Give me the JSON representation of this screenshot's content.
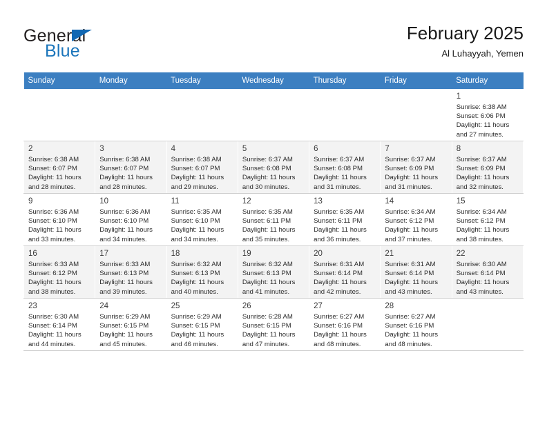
{
  "brand": {
    "name_part1": "General",
    "name_part2": "Blue",
    "triangle_color": "#1268b3",
    "blue_color": "#1b75bb"
  },
  "header": {
    "title": "February 2025",
    "subtitle": "Al Luhayyah, Yemen"
  },
  "colors": {
    "header_row_bg": "#3c7fc1",
    "header_row_text": "#ffffff",
    "week_stripe_bg": "#f3f3f3",
    "cell_bg": "#ffffff",
    "grid_line": "#cfcfcf"
  },
  "weekdays": [
    "Sunday",
    "Monday",
    "Tuesday",
    "Wednesday",
    "Thursday",
    "Friday",
    "Saturday"
  ],
  "weeks": [
    [
      {
        "day": "",
        "info": ""
      },
      {
        "day": "",
        "info": ""
      },
      {
        "day": "",
        "info": ""
      },
      {
        "day": "",
        "info": ""
      },
      {
        "day": "",
        "info": ""
      },
      {
        "day": "",
        "info": ""
      },
      {
        "day": "1",
        "info": "Sunrise: 6:38 AM\nSunset: 6:06 PM\nDaylight: 11 hours\nand 27 minutes."
      }
    ],
    [
      {
        "day": "2",
        "info": "Sunrise: 6:38 AM\nSunset: 6:07 PM\nDaylight: 11 hours\nand 28 minutes."
      },
      {
        "day": "3",
        "info": "Sunrise: 6:38 AM\nSunset: 6:07 PM\nDaylight: 11 hours\nand 28 minutes."
      },
      {
        "day": "4",
        "info": "Sunrise: 6:38 AM\nSunset: 6:07 PM\nDaylight: 11 hours\nand 29 minutes."
      },
      {
        "day": "5",
        "info": "Sunrise: 6:37 AM\nSunset: 6:08 PM\nDaylight: 11 hours\nand 30 minutes."
      },
      {
        "day": "6",
        "info": "Sunrise: 6:37 AM\nSunset: 6:08 PM\nDaylight: 11 hours\nand 31 minutes."
      },
      {
        "day": "7",
        "info": "Sunrise: 6:37 AM\nSunset: 6:09 PM\nDaylight: 11 hours\nand 31 minutes."
      },
      {
        "day": "8",
        "info": "Sunrise: 6:37 AM\nSunset: 6:09 PM\nDaylight: 11 hours\nand 32 minutes."
      }
    ],
    [
      {
        "day": "9",
        "info": "Sunrise: 6:36 AM\nSunset: 6:10 PM\nDaylight: 11 hours\nand 33 minutes."
      },
      {
        "day": "10",
        "info": "Sunrise: 6:36 AM\nSunset: 6:10 PM\nDaylight: 11 hours\nand 34 minutes."
      },
      {
        "day": "11",
        "info": "Sunrise: 6:35 AM\nSunset: 6:10 PM\nDaylight: 11 hours\nand 34 minutes."
      },
      {
        "day": "12",
        "info": "Sunrise: 6:35 AM\nSunset: 6:11 PM\nDaylight: 11 hours\nand 35 minutes."
      },
      {
        "day": "13",
        "info": "Sunrise: 6:35 AM\nSunset: 6:11 PM\nDaylight: 11 hours\nand 36 minutes."
      },
      {
        "day": "14",
        "info": "Sunrise: 6:34 AM\nSunset: 6:12 PM\nDaylight: 11 hours\nand 37 minutes."
      },
      {
        "day": "15",
        "info": "Sunrise: 6:34 AM\nSunset: 6:12 PM\nDaylight: 11 hours\nand 38 minutes."
      }
    ],
    [
      {
        "day": "16",
        "info": "Sunrise: 6:33 AM\nSunset: 6:12 PM\nDaylight: 11 hours\nand 38 minutes."
      },
      {
        "day": "17",
        "info": "Sunrise: 6:33 AM\nSunset: 6:13 PM\nDaylight: 11 hours\nand 39 minutes."
      },
      {
        "day": "18",
        "info": "Sunrise: 6:32 AM\nSunset: 6:13 PM\nDaylight: 11 hours\nand 40 minutes."
      },
      {
        "day": "19",
        "info": "Sunrise: 6:32 AM\nSunset: 6:13 PM\nDaylight: 11 hours\nand 41 minutes."
      },
      {
        "day": "20",
        "info": "Sunrise: 6:31 AM\nSunset: 6:14 PM\nDaylight: 11 hours\nand 42 minutes."
      },
      {
        "day": "21",
        "info": "Sunrise: 6:31 AM\nSunset: 6:14 PM\nDaylight: 11 hours\nand 43 minutes."
      },
      {
        "day": "22",
        "info": "Sunrise: 6:30 AM\nSunset: 6:14 PM\nDaylight: 11 hours\nand 43 minutes."
      }
    ],
    [
      {
        "day": "23",
        "info": "Sunrise: 6:30 AM\nSunset: 6:14 PM\nDaylight: 11 hours\nand 44 minutes."
      },
      {
        "day": "24",
        "info": "Sunrise: 6:29 AM\nSunset: 6:15 PM\nDaylight: 11 hours\nand 45 minutes."
      },
      {
        "day": "25",
        "info": "Sunrise: 6:29 AM\nSunset: 6:15 PM\nDaylight: 11 hours\nand 46 minutes."
      },
      {
        "day": "26",
        "info": "Sunrise: 6:28 AM\nSunset: 6:15 PM\nDaylight: 11 hours\nand 47 minutes."
      },
      {
        "day": "27",
        "info": "Sunrise: 6:27 AM\nSunset: 6:16 PM\nDaylight: 11 hours\nand 48 minutes."
      },
      {
        "day": "28",
        "info": "Sunrise: 6:27 AM\nSunset: 6:16 PM\nDaylight: 11 hours\nand 48 minutes."
      },
      {
        "day": "",
        "info": ""
      }
    ]
  ]
}
